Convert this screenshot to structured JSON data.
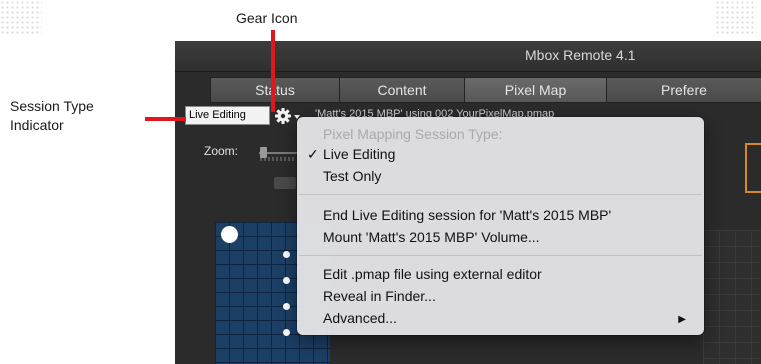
{
  "callouts": {
    "gear_icon_label": "Gear Icon",
    "session_type_label_line1": "Session Type",
    "session_type_label_line2": "Indicator",
    "accent_color": "#e0181e"
  },
  "window": {
    "title": "Mbox Remote 4.1"
  },
  "tabs": [
    {
      "label": "Status"
    },
    {
      "label": "Content"
    },
    {
      "label": "Pixel Map",
      "active": true
    },
    {
      "label": "Prefere"
    }
  ],
  "toolbar": {
    "session_type_value": "Live Editing",
    "gear_icon": "gear-icon",
    "file_path_text": "'Matt's 2015 MBP' using 002 YourPixelMap.pmap"
  },
  "zoom": {
    "label": "Zoom:"
  },
  "menu": {
    "header": "Pixel Mapping Session Type:",
    "live_editing": "Live Editing",
    "live_editing_checked": true,
    "test_only": "Test Only",
    "end_session": "End Live Editing session for 'Matt's 2015 MBP'",
    "mount_volume": "Mount 'Matt's 2015 MBP' Volume...",
    "edit_pmap": "Edit .pmap file using external editor",
    "reveal_finder": "Reveal in Finder...",
    "advanced": "Advanced...",
    "check_glyph": "✓",
    "submenu_arrow": "▶"
  }
}
